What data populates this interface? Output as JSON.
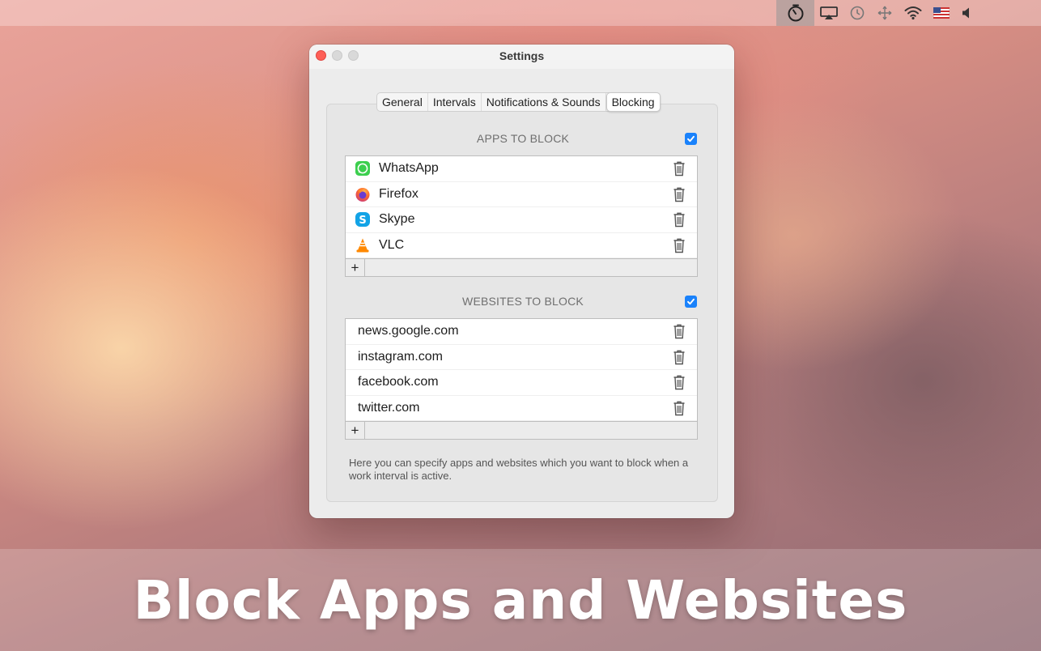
{
  "menubar": {
    "icons": [
      "timer-icon",
      "airplay-icon",
      "time-machine-icon",
      "move-arrows-icon",
      "wifi-icon",
      "us-flag-icon",
      "volume-icon"
    ]
  },
  "window": {
    "title": "Settings",
    "tabs": [
      {
        "label": "General",
        "selected": false
      },
      {
        "label": "Intervals",
        "selected": false
      },
      {
        "label": "Notifications & Sounds",
        "selected": false
      },
      {
        "label": "Blocking",
        "selected": true
      }
    ],
    "apps_section": {
      "heading": "APPS TO BLOCK",
      "checked": true,
      "items": [
        {
          "label": "WhatsApp",
          "icon": "whatsapp-icon"
        },
        {
          "label": "Firefox",
          "icon": "firefox-icon"
        },
        {
          "label": "Skype",
          "icon": "skype-icon"
        },
        {
          "label": "VLC",
          "icon": "vlc-icon"
        }
      ],
      "add_label": "+"
    },
    "websites_section": {
      "heading": "WEBSITES TO BLOCK",
      "checked": true,
      "items": [
        {
          "label": "news.google.com"
        },
        {
          "label": "instagram.com"
        },
        {
          "label": "facebook.com"
        },
        {
          "label": "twitter.com"
        }
      ],
      "add_label": "+"
    },
    "help_text": "Here you can specify apps and websites which you want to block when a work interval is active."
  },
  "caption": "Block Apps and Websites",
  "colors": {
    "accent": "#1a82fb",
    "close": "#fe5f57"
  }
}
